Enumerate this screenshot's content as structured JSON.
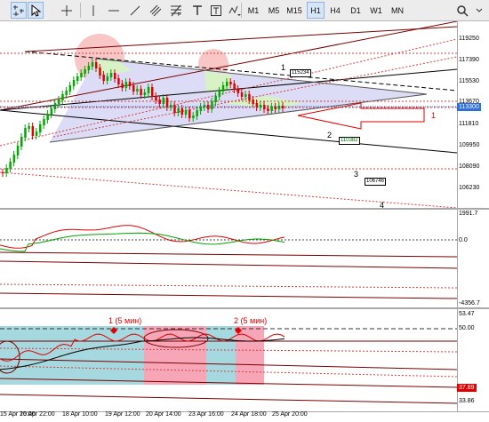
{
  "toolbar": {
    "tools": [
      {
        "name": "crosshair-tool",
        "active": true
      },
      {
        "name": "pointer-tool",
        "active": true
      },
      {
        "name": "cross-tool",
        "active": false
      },
      {
        "name": "vertical-line-tool",
        "active": false
      },
      {
        "name": "horizontal-line-tool",
        "active": false
      },
      {
        "name": "trend-line-tool",
        "active": false
      },
      {
        "name": "equidistant-channel-tool",
        "active": false
      },
      {
        "name": "fibonacci-tool",
        "active": false
      },
      {
        "name": "text-tool",
        "active": false
      },
      {
        "name": "text-label-tool",
        "active": false
      },
      {
        "name": "shapes-dropdown",
        "active": false
      }
    ],
    "timeframes": [
      "M1",
      "M5",
      "M15",
      "H1",
      "H4",
      "D1",
      "W1",
      "MN"
    ],
    "active_timeframe": "H1",
    "search_icon": "search-icon"
  },
  "price_axis": {
    "labels": [
      "119250",
      "117390",
      "115530",
      "113670",
      "111810",
      "109950",
      "108090",
      "106230"
    ],
    "current_price": "113300",
    "current_price_color": "#2e6fd8"
  },
  "indicator1_axis": {
    "labels": [
      "1991.7",
      "0.0",
      "-4356.7"
    ]
  },
  "indicator2_axis": {
    "labels": [
      "53.47",
      "50.00",
      "33.86"
    ],
    "current_value": "37.89",
    "current_value_color": "#e00000"
  },
  "time_axis": {
    "labels": [
      "15 Apr 20:00",
      "16 Apr 22:00",
      "18 Apr 10:00",
      "19 Apr 12:00",
      "20 Apr 14:00",
      "23 Apr 16:00",
      "24 Apr 18:00",
      "25 Apr 20:00"
    ]
  },
  "annotations": {
    "level_1": "1",
    "level_2": "2",
    "level_3": "3",
    "level_4": "4",
    "label_115234": "115234",
    "label_110382": "110382",
    "label_106746": "106746",
    "arrow_label": "1",
    "osc_mark_1": "1  (5 мин)",
    "osc_mark_2": "2  (5 мин)"
  },
  "colors": {
    "up_candle": "#00aa00",
    "down_candle": "#e00000",
    "triangle_fill": "#dcdcf6",
    "red_highlight": "#f7a6b7",
    "cyan_band": "#a6d8e0",
    "macd_red": "#e00000",
    "macd_green": "#00a000"
  }
}
